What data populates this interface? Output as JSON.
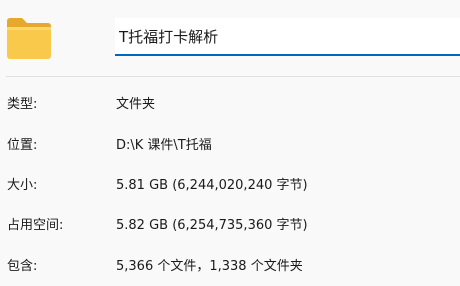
{
  "header": {
    "folder_icon": "folder-icon",
    "folder_color": "#f5c342",
    "name_value": "T托福打卡解析",
    "accent_color": "#0067c0"
  },
  "properties": {
    "type": {
      "label": "类型:",
      "value": "文件夹"
    },
    "location": {
      "label": "位置:",
      "value": "D:\\K 课件\\T托福"
    },
    "size": {
      "label": "大小:",
      "value": "5.81 GB (6,244,020,240 字节)"
    },
    "disk": {
      "label": "占用空间:",
      "value": "5.82 GB (6,254,735,360 字节)"
    },
    "contains": {
      "label": "包含:",
      "value": "5,366 个文件，1,338 个文件夹"
    }
  }
}
